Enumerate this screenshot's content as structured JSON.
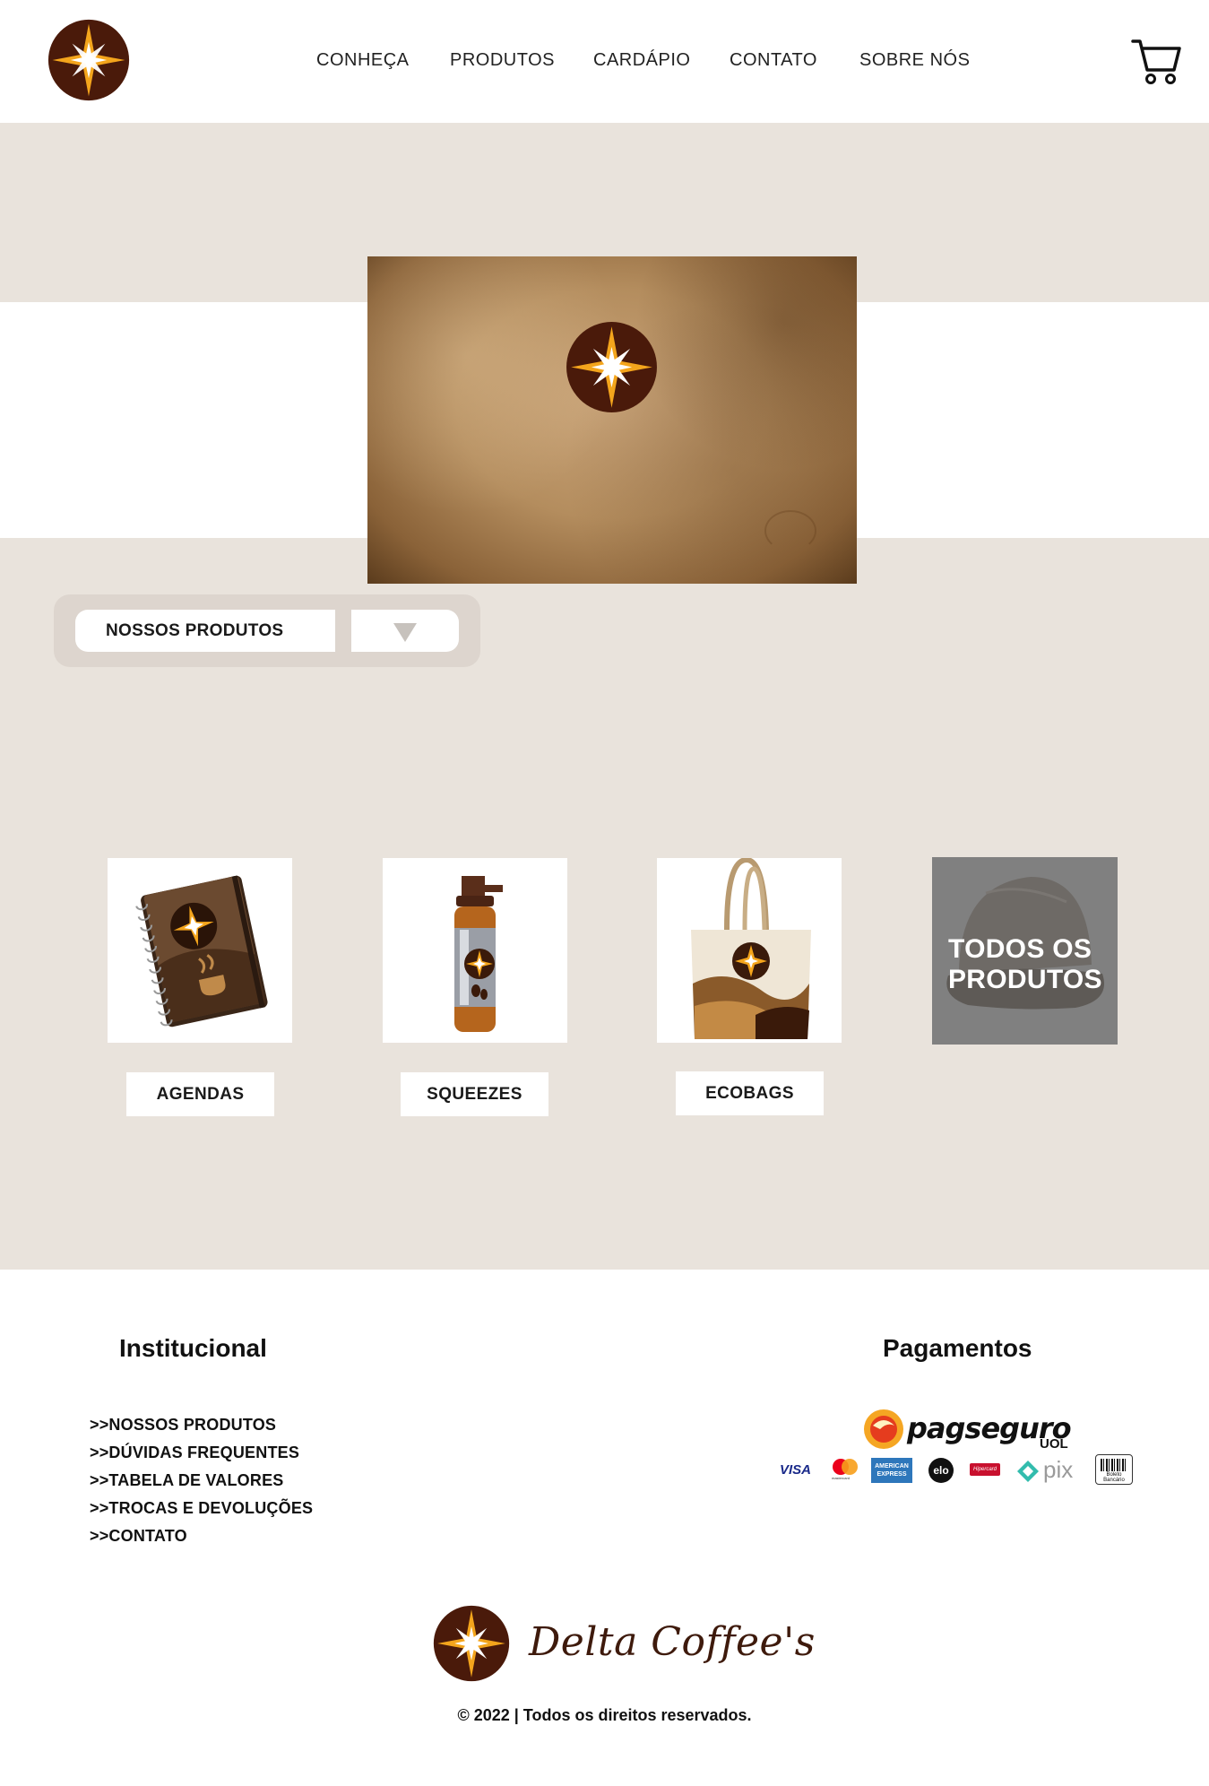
{
  "brand": {
    "name": "Delta Coffee's",
    "colors": {
      "dark_brown": "#4a1a0a",
      "gold": "#f4a51c",
      "beige": "#e9e3dc"
    }
  },
  "header": {
    "nav": [
      "CONHEÇA",
      "PRODUTOS",
      "CARDÁPIO",
      "CONTATO",
      "SOBRE NÓS"
    ],
    "cart_icon": "shopping-cart-icon",
    "logo_icon": "compass-star-logo"
  },
  "dropdown": {
    "label": "NOSSOS PRODUTOS",
    "icon": "triangle-down-icon"
  },
  "products": [
    {
      "label": "AGENDAS",
      "icon": "notebook-image"
    },
    {
      "label": "SQUEEZES",
      "icon": "bottle-image"
    },
    {
      "label": "ECOBAGS",
      "icon": "tote-bag-image"
    }
  ],
  "all_products": {
    "line1": "TODOS OS",
    "line2": "PRODUTOS"
  },
  "footer": {
    "institucional_title": "Institucional",
    "links": [
      ">>NOSSOS PRODUTOS",
      ">>DÚVIDAS FREQUENTES",
      ">>TABELA DE VALORES",
      ">>TROCAS E DEVOLUÇÕES",
      ">>CONTATO"
    ],
    "pagamentos_title": "Pagamentos",
    "pagseguro": {
      "name": "pagseguro",
      "sub": "UOL"
    },
    "payment_methods": {
      "visa": "VISA",
      "mastercard": "mastercard",
      "amex": "AMERICAN EXPRESS",
      "elo": "elo",
      "hipercard": "Hipercard",
      "pix": "pix",
      "boleto": "Boleto Bancário"
    },
    "copyright": "© 2022 | Todos os direitos reservados."
  }
}
